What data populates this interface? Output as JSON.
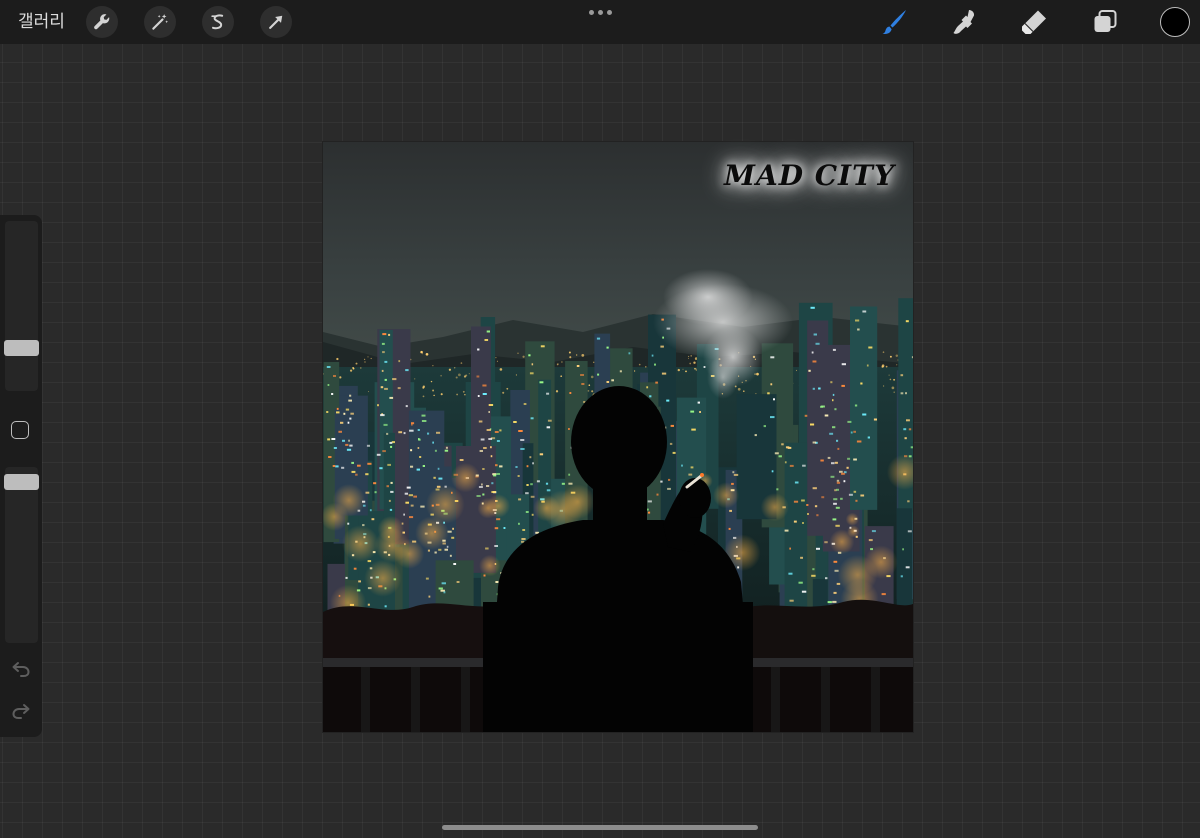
{
  "toolbar": {
    "gallery_label": "갤러리",
    "left_tools": [
      {
        "name": "actions",
        "icon": "wrench-icon"
      },
      {
        "name": "adjustments",
        "icon": "magic-wand-icon"
      },
      {
        "name": "selection",
        "icon": "selection-s-icon"
      },
      {
        "name": "transform",
        "icon": "arrow-cursor-icon"
      }
    ],
    "more_icon": "ellipsis-icon",
    "right_tools": [
      {
        "name": "brush",
        "icon": "brush-icon",
        "active": true
      },
      {
        "name": "smudge",
        "icon": "smudge-icon",
        "active": false
      },
      {
        "name": "eraser",
        "icon": "eraser-icon",
        "active": false
      },
      {
        "name": "layers",
        "icon": "layers-icon",
        "active": false
      }
    ],
    "current_color": "#000000",
    "active_color": "#2f7fe0"
  },
  "sidebar": {
    "brush_size_level": 0.74,
    "opacity_level": 1.0,
    "modify_icon": "square-icon",
    "undo_icon": "undo-icon",
    "redo_icon": "redo-icon"
  },
  "canvas": {
    "caption": "MAD CITY"
  }
}
